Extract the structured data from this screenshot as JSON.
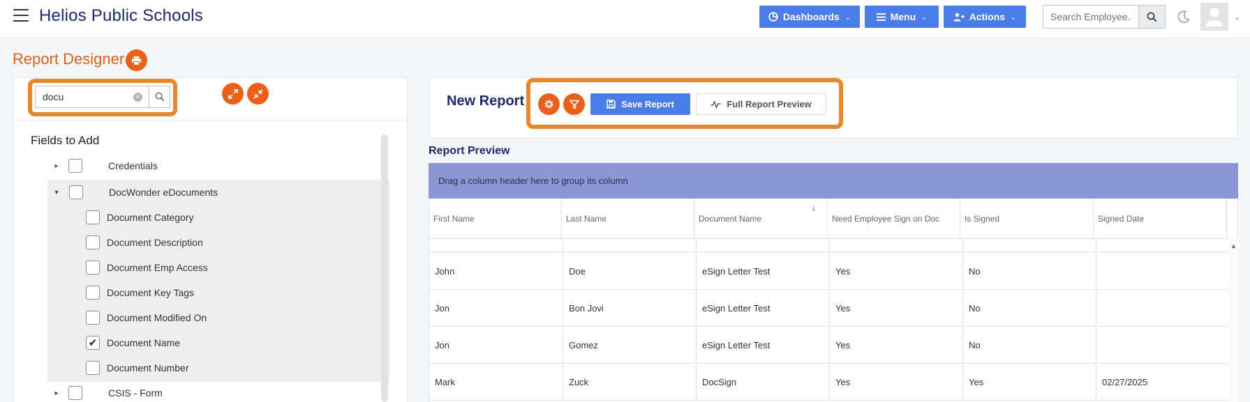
{
  "header": {
    "brand": "Helios Public Schools",
    "buttons": {
      "dashboards": "Dashboards",
      "menu": "Menu",
      "actions": "Actions"
    },
    "search": {
      "placeholder": "Search Employee..",
      "value": ""
    },
    "icons": [
      "menu-icon",
      "dashboard-icon",
      "list-icon",
      "user-plus-icon",
      "search-icon",
      "moon-icon",
      "user-avatar-icon",
      "chevron-down-icon"
    ]
  },
  "page": {
    "title": "Report Designer",
    "title_icon": "print-icon"
  },
  "fields_panel": {
    "search_value": "docu",
    "title": "Fields to Add",
    "expand_icon": "expand-icon",
    "collapse_icon": "collapse-icon",
    "groups": [
      {
        "label": "Credentials",
        "expanded": false,
        "checked": false
      },
      {
        "label": "DocWonder eDocuments",
        "expanded": true,
        "checked": false,
        "children": [
          {
            "label": "Document Category",
            "checked": false
          },
          {
            "label": "Document Description",
            "checked": false
          },
          {
            "label": "Document Emp Access",
            "checked": false
          },
          {
            "label": "Document Key Tags",
            "checked": false
          },
          {
            "label": "Document Modified On",
            "checked": false
          },
          {
            "label": "Document Name",
            "checked": true
          },
          {
            "label": "Document Number",
            "checked": false
          }
        ]
      },
      {
        "label": "CSIS - Form",
        "expanded": false,
        "checked": false
      }
    ]
  },
  "report": {
    "title": "New Report",
    "save_label": "Save Report",
    "preview_label": "Full Report Preview",
    "preview_title": "Report Preview",
    "group_hint": "Drag a column header here to group its column",
    "columns": [
      "First Name",
      "Last Name",
      "Document Name",
      "Need Employee Sign on Doc",
      "Is Signed",
      "Signed Date"
    ],
    "sorted_column": "Document Name",
    "sort_direction": "descending",
    "rows": [
      [
        "John",
        "Doe",
        "eSign Letter Test",
        "Yes",
        "No",
        ""
      ],
      [
        "Jon",
        "Bon Jovi",
        "eSign Letter Test",
        "Yes",
        "No",
        ""
      ],
      [
        "Jon",
        "Gomez",
        "eSign Letter Test",
        "Yes",
        "No",
        ""
      ],
      [
        "Mark",
        "Zuck",
        "DocSign",
        "Yes",
        "Yes",
        "02/27/2025"
      ]
    ]
  },
  "colors": {
    "brand_blue": "#4a7de8",
    "orange": "#e8601a",
    "highlight": "#e8862b",
    "navy": "#1c2a6b",
    "group_bar": "#8b97d4"
  }
}
